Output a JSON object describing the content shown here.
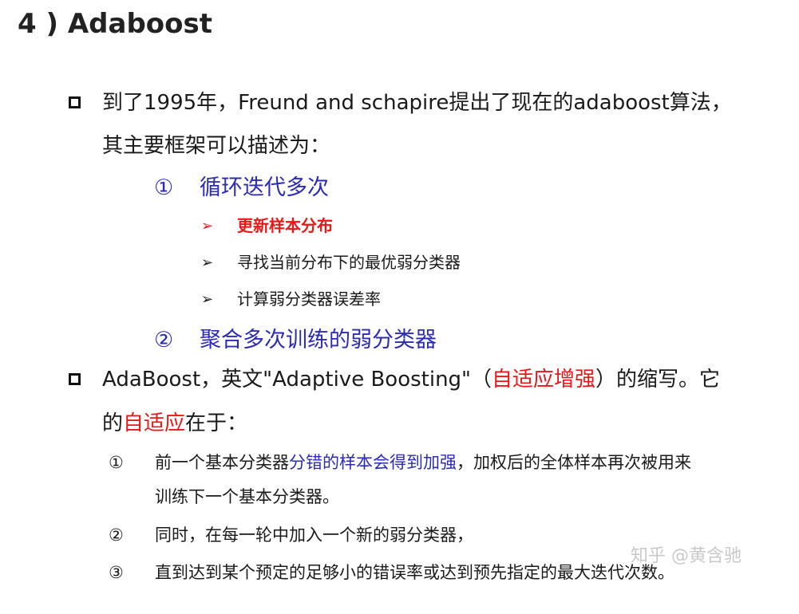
{
  "title": "4 ) Adaboost",
  "bullet1": {
    "line1": "到了1995年，Freund and schapire提出了现在的adaboost算法，",
    "line2": "其主要框架可以描述为："
  },
  "step1": {
    "num": "①",
    "label": "循环迭代多次"
  },
  "substeps": [
    {
      "arrow": "➢",
      "label": "更新样本分布"
    },
    {
      "arrow": "➢",
      "label": "寻找当前分布下的最优弱分类器"
    },
    {
      "arrow": "➢",
      "label": "计算弱分类器误差率"
    }
  ],
  "step2": {
    "num": "②",
    "label": "聚合多次训练的弱分类器"
  },
  "bullet2": {
    "line1_a": "AdaBoost，英文\"Adaptive Boosting\"（",
    "line1_red": "自适应增强",
    "line1_b": "）的缩写。它",
    "line2_a": "的",
    "line2_red": "自适应",
    "line2_b": "在于："
  },
  "points": [
    {
      "num": "①",
      "a": "前一个基本分类器",
      "blue": "分错的样本会得到加强",
      "b": "，加权后的全体样本再次被用来",
      "cont": "训练下一个基本分类器。"
    },
    {
      "num": "②",
      "text": "同时，在每一轮中加入一个新的弱分类器，"
    },
    {
      "num": "③",
      "text": "直到达到某个预定的足够小的错误率或达到预先指定的最大迭代次数。"
    }
  ],
  "watermark": "知乎 @黄含驰",
  "colors": {
    "red": "#e81818",
    "blue": "#2b2bb3",
    "text": "#1a1a1a"
  }
}
